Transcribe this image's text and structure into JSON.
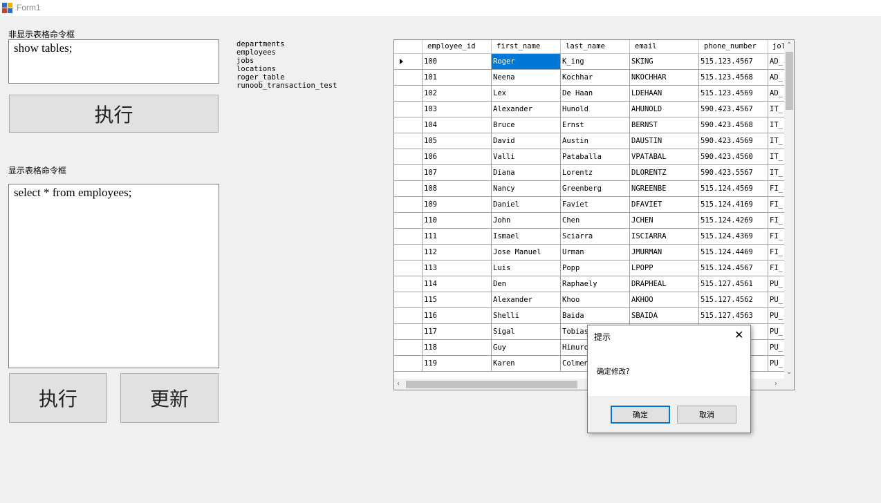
{
  "window": {
    "title": "Form1"
  },
  "left_panel": {
    "non_table_label": "非显示表格命令框",
    "non_table_command": "show tables;",
    "execute_label_1": "执行",
    "table_label": "显示表格命令框",
    "table_command": "select * from employees;",
    "execute_label_2": "执行",
    "update_label": "更新"
  },
  "table_list": [
    "departments",
    "employees",
    "jobs",
    "locations",
    "roger_table",
    "runoob_transaction_test"
  ],
  "grid": {
    "columns": [
      "employee_id",
      "first_name",
      "last_name",
      "email",
      "phone_number",
      "jol"
    ],
    "rows": [
      [
        "100",
        "Roger",
        "K_ing",
        "SKING",
        "515.123.4567",
        "AD_"
      ],
      [
        "101",
        "Neena",
        "Kochhar",
        "NKOCHHAR",
        "515.123.4568",
        "AD_"
      ],
      [
        "102",
        "Lex",
        "De Haan",
        "LDEHAAN",
        "515.123.4569",
        "AD_"
      ],
      [
        "103",
        "Alexander",
        "Hunold",
        "AHUNOLD",
        "590.423.4567",
        "IT_"
      ],
      [
        "104",
        "Bruce",
        "Ernst",
        "BERNST",
        "590.423.4568",
        "IT_"
      ],
      [
        "105",
        "David",
        "Austin",
        "DAUSTIN",
        "590.423.4569",
        "IT_"
      ],
      [
        "106",
        "Valli",
        "Pataballa",
        "VPATABAL",
        "590.423.4560",
        "IT_"
      ],
      [
        "107",
        "Diana",
        "Lorentz",
        "DLORENTZ",
        "590.423.5567",
        "IT_"
      ],
      [
        "108",
        "Nancy",
        "Greenberg",
        "NGREENBE",
        "515.124.4569",
        "FI_"
      ],
      [
        "109",
        "Daniel",
        "Faviet",
        "DFAVIET",
        "515.124.4169",
        "FI_"
      ],
      [
        "110",
        "John",
        "Chen",
        "JCHEN",
        "515.124.4269",
        "FI_"
      ],
      [
        "111",
        "Ismael",
        "Sciarra",
        "ISCIARRA",
        "515.124.4369",
        "FI_"
      ],
      [
        "112",
        "Jose Manuel",
        "Urman",
        "JMURMAN",
        "515.124.4469",
        "FI_"
      ],
      [
        "113",
        "Luis",
        "Popp",
        "LPOPP",
        "515.124.4567",
        "FI_"
      ],
      [
        "114",
        "Den",
        "Raphaely",
        "DRAPHEAL",
        "515.127.4561",
        "PU_"
      ],
      [
        "115",
        "Alexander",
        "Khoo",
        "AKHOO",
        "515.127.4562",
        "PU_"
      ],
      [
        "116",
        "Shelli",
        "Baida",
        "SBAIDA",
        "515.127.4563",
        "PU_"
      ],
      [
        "117",
        "Sigal",
        "Tobias",
        "",
        "",
        "PU_"
      ],
      [
        "118",
        "Guy",
        "Himuro",
        "",
        "",
        "PU_"
      ],
      [
        "119",
        "Karen",
        "Colmen",
        "",
        "",
        "PU_"
      ]
    ]
  },
  "dialog": {
    "title": "提示",
    "message": "确定修改?",
    "ok_label": "确定",
    "cancel_label": "取消",
    "close_glyph": "✕"
  },
  "colors": {
    "background": "#f0f0f0",
    "selection": "#0078d7",
    "button_face": "#e1e1e1"
  }
}
